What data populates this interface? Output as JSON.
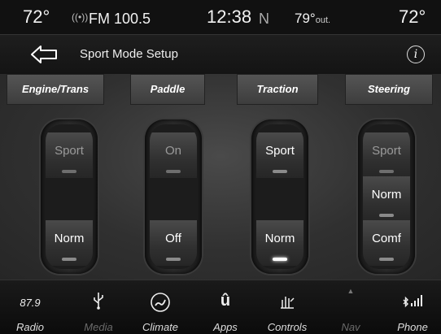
{
  "status": {
    "temp_left": "72°",
    "radio_icon": "broadcast-icon",
    "station": "FM 100.5",
    "time": "12:38",
    "compass": "N",
    "outside_temp": "79°",
    "outside_label": "out.",
    "temp_right": "72°"
  },
  "header": {
    "back_icon": "back-arrow-icon",
    "title": "Sport Mode Setup",
    "info_icon": "info-icon",
    "info_glyph": "i"
  },
  "tabs": [
    {
      "label": "Engine/Trans"
    },
    {
      "label": "Paddle"
    },
    {
      "label": "Traction"
    },
    {
      "label": "Steering"
    }
  ],
  "columns": [
    {
      "options": [
        {
          "label": "Sport",
          "state": "dim"
        },
        {
          "label": "Norm",
          "state": "normal"
        }
      ]
    },
    {
      "options": [
        {
          "label": "On",
          "state": "dim"
        },
        {
          "label": "Off",
          "state": "normal"
        }
      ]
    },
    {
      "options": [
        {
          "label": "Sport",
          "state": "normal"
        },
        {
          "label": "Norm",
          "state": "active"
        }
      ]
    },
    {
      "options": [
        {
          "label": "Sport",
          "state": "dim"
        },
        {
          "label": "Norm",
          "state": "normal"
        },
        {
          "label": "Comf",
          "state": "normal"
        }
      ]
    }
  ],
  "nav": [
    {
      "label": "Radio",
      "top_text": "87.9",
      "icon": "radio-frequency"
    },
    {
      "label": "Media",
      "icon": "usb-icon",
      "state": "dim"
    },
    {
      "label": "Climate",
      "icon": "climate-icon"
    },
    {
      "label": "Apps",
      "icon": "apps-icon"
    },
    {
      "label": "Controls",
      "icon": "controls-icon"
    },
    {
      "label": "Nav",
      "icon": "nav-icon",
      "state": "dim"
    },
    {
      "label": "Phone",
      "icon": "phone-icon"
    }
  ]
}
